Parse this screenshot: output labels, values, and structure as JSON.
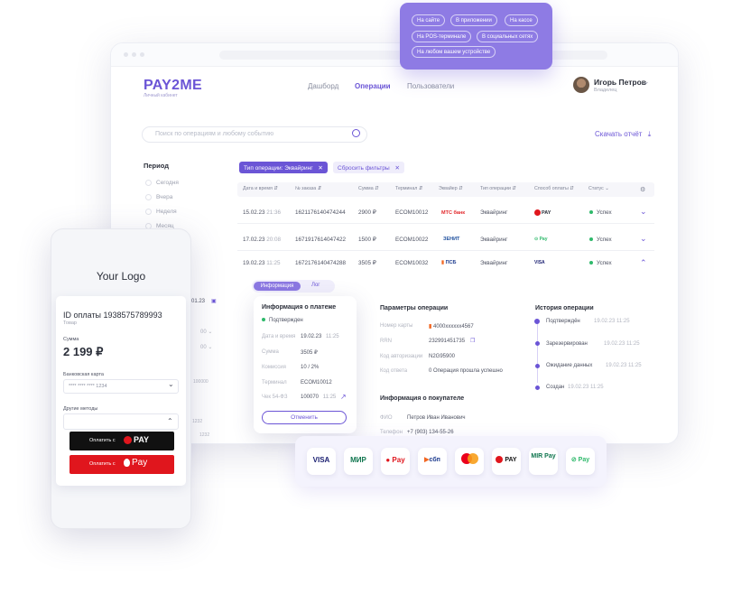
{
  "popover": {
    "tags": [
      "На сайте",
      "В приложении",
      "На кассе",
      "На POS-терминале",
      "В социальных сетях",
      "На любом вашем устройстве"
    ]
  },
  "header": {
    "logo": "PAY2ME",
    "logo_sub": "Личный кабинет",
    "nav": [
      "Дашборд",
      "Операции",
      "Пользователи"
    ],
    "user_name": "Игорь Петров",
    "user_role": "Владелец"
  },
  "search": {
    "placeholder": "Поиск по операциям и любому событию"
  },
  "download_label": "Скачать отчёт",
  "period": {
    "title": "Период",
    "options": [
      "Сегодня",
      "Вчера",
      "Неделя",
      "Месяц"
    ]
  },
  "filters": {
    "active_chip": "Тип операции: Эквайринг",
    "reset": "Сбросить фильтры"
  },
  "table": {
    "headers": [
      "Дата и время",
      "№ заказа",
      "Сумма",
      "Терминал",
      "Эквайер",
      "Тип операции",
      "Способ оплаты",
      "Статус"
    ],
    "rows": [
      {
        "date": "15.02.23",
        "time": "21:36",
        "order": "1621176140474244",
        "sum": "2900 ₽",
        "terminal": "ECOM10012",
        "acquirer": "МТС банк",
        "type": "Эквайринг",
        "method": "PAY",
        "status": "Успех"
      },
      {
        "date": "17.02.23",
        "time": "20:08",
        "order": "1671917614047422",
        "sum": "1500 ₽",
        "terminal": "ECOM10022",
        "acquirer": "ЗЕНИТ",
        "type": "Эквайринг",
        "method": "Pay",
        "status": "Успех"
      },
      {
        "date": "19.02.23",
        "time": "11:25",
        "order": "1672176140474288",
        "sum": "3505 ₽",
        "terminal": "ECOM10032",
        "acquirer": "ПСБ",
        "type": "Эквайринг",
        "method": "VISA",
        "status": "Успех"
      }
    ]
  },
  "detail_tabs": [
    "Информация",
    "Лог"
  ],
  "payment_info": {
    "title": "Информация о платеже",
    "status": "Подтвержден",
    "fields": [
      {
        "k": "Дата и время",
        "v": "19.02.23",
        "v2": "11:25"
      },
      {
        "k": "Сумма",
        "v": "3505 ₽"
      },
      {
        "k": "Комиссия",
        "v": "10 / 2%"
      },
      {
        "k": "Терминал",
        "v": "ECOM10012"
      },
      {
        "k": "Чек 54-ФЗ",
        "v": "100070",
        "v2": "11:25"
      }
    ],
    "cancel": "Отменить"
  },
  "operation_params": {
    "title": "Параметры операции",
    "fields": [
      {
        "k": "Номер карты",
        "v": "4000xxxxxx4567"
      },
      {
        "k": "RRN",
        "v": "232991451735"
      },
      {
        "k": "Код авторизации",
        "v": "N2G95900"
      },
      {
        "k": "Код ответа",
        "v": "0  Операция прошла успешно"
      }
    ]
  },
  "buyer": {
    "title": "Информация о покупателе",
    "fields": [
      {
        "k": "ФИО",
        "v": "Петров Иван Иванович"
      },
      {
        "k": "Телефон",
        "v": "+7 (903) 134-55-26"
      }
    ]
  },
  "history": {
    "title": "История операции",
    "events": [
      {
        "label": "Подтверждён",
        "date": "19.02.23 11:25"
      },
      {
        "label": "Зарезервирован",
        "date": "19.02.23 11:25"
      },
      {
        "label": "Ожидание данных",
        "date": "19.02.23 11:25"
      },
      {
        "label": "Создан",
        "date": "19.02.23 11:25"
      }
    ]
  },
  "phone": {
    "logo": "Your Logo",
    "payment_id": "ID оплаты 1938575789993",
    "product": "Товар",
    "sum_label": "Сумма",
    "sum": "2 199 ₽",
    "card_label": "Банковская карта",
    "card_mask": "**** **** **** 1234",
    "other_methods": "Другие методы",
    "pay_with": "Оплатить с",
    "pay_brand": "PAY",
    "pay_brand2": "Pay"
  },
  "bg_fragments": {
    "date_frag": "01.23",
    "amount_frag1": "00",
    "amount_frag2": "00",
    "num_frag1": "100000",
    "num_frag2": "1232",
    "num_frag3": "1232",
    "label_frag": "д."
  },
  "pay_methods": [
    "VISA",
    "МИР",
    "Pay",
    "сбп",
    "mastercard",
    "PAY",
    "MIR Pay",
    "Pay"
  ],
  "colors": {
    "accent": "#6b55d6",
    "success": "#2fb96b",
    "red": "#e0161d"
  }
}
